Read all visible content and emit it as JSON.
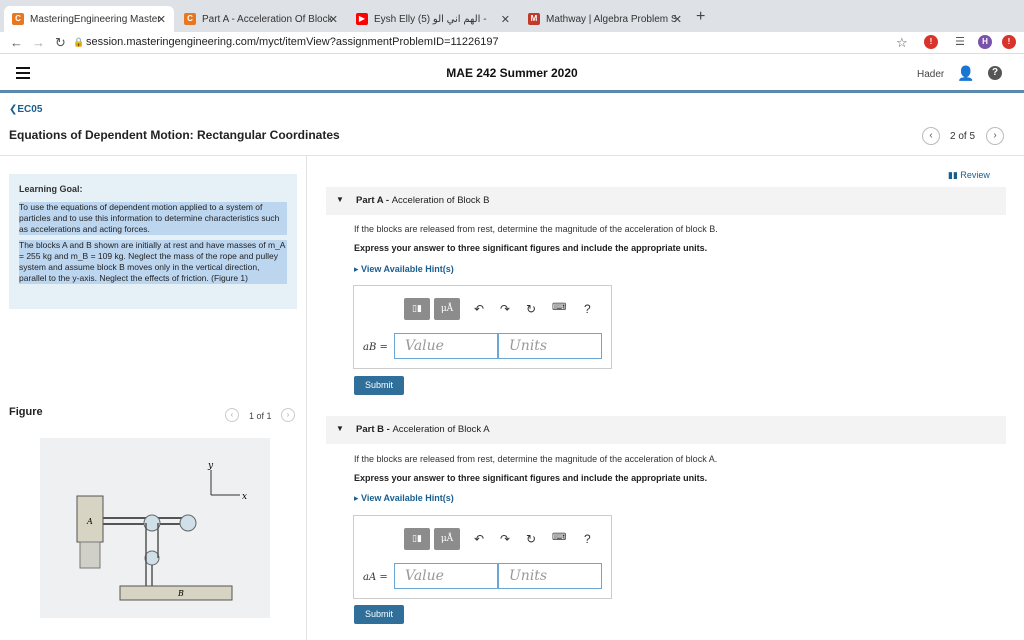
{
  "browser": {
    "tabs": [
      {
        "title": "MasteringEngineering Masterin",
        "icon_color": "#e87722"
      },
      {
        "title": "Part A - Acceleration Of Block",
        "icon_color": "#e87722"
      },
      {
        "title": "Eysh Elly (5) الهم اني ألو - ",
        "icon_color": "#ff0000"
      },
      {
        "title": "Mathway | Algebra Problem So",
        "icon_color": "#c0392b"
      }
    ],
    "url": "session.masteringengineering.com/myct/itemView?assignmentProblemID=11226197"
  },
  "header": {
    "course": "MAE 242 Summer 2020",
    "user": "Hader"
  },
  "page": {
    "back": "❮EC05",
    "title": "Equations of Dependent Motion: Rectangular Coordinates",
    "pager": "2 of 5"
  },
  "goal": {
    "title": "Learning Goal:",
    "p1": "To use the equations of dependent motion applied to a system of particles and to use this information to determine characteristics such as accelerations and acting forces.",
    "p2": "The blocks A and B shown are initially at rest and have masses of m_A = 255 kg and m_B = 109 kg. Neglect the mass of the rope and pulley system and assume block B moves only in the vertical direction, parallel to the y-axis. Neglect the effects of friction. (Figure 1)"
  },
  "figure": {
    "title": "Figure",
    "count": "1 of 1",
    "labels": {
      "y": "y",
      "x": "x",
      "A": "A",
      "B": "B"
    }
  },
  "review": "Review",
  "parts": [
    {
      "head_prefix": "Part A - ",
      "head": "Acceleration of Block B",
      "question": "If the blocks are released from rest, determine the magnitude of the acceleration of block B.",
      "instruction": "Express your answer to three significant figures and include the appropriate units.",
      "hint": "View Available Hint(s)",
      "var": "aB =",
      "value_placeholder": "Value",
      "units_placeholder": "Units",
      "submit": "Submit"
    },
    {
      "head_prefix": "Part B - ",
      "head": "Acceleration of Block A",
      "question": "If the blocks are released from rest, determine the magnitude of the acceleration of block A.",
      "instruction": "Express your answer to three significant figures and include the appropriate units.",
      "hint": "View Available Hint(s)",
      "var": "aA =",
      "value_placeholder": "Value",
      "units_placeholder": "Units",
      "submit": "Submit"
    }
  ],
  "toolbar": {
    "template": "▯▮",
    "mu": "μÅ",
    "question": "?"
  }
}
